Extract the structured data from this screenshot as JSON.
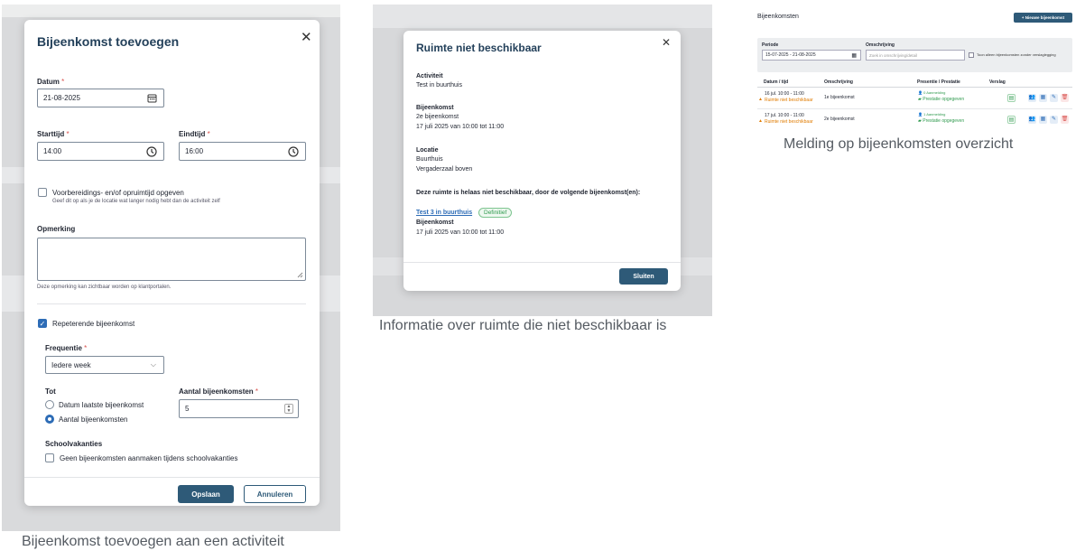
{
  "panel1": {
    "title": "Bijeenkomst toevoegen",
    "date_label": "Datum",
    "date_value": "21-08-2025",
    "start_label": "Starttijd",
    "start_value": "14:00",
    "end_label": "Eindtijd",
    "end_value": "16:00",
    "prep_label": "Voorbereidings- en/of opruimtijd opgeven",
    "prep_help": "Geef dit op als je de locatie wat langer nodig hebt dan de activiteit zelf",
    "remark_label": "Opmerking",
    "remark_help": "Deze opmerking kan zichtbaar worden op klantportalen.",
    "repeat_label": "Repeterende bijeenkomst",
    "freq_label": "Frequentie",
    "freq_value": "Iedere week",
    "until_label": "Tot",
    "until_opt1": "Datum laatste bijeenkomst",
    "until_opt2": "Aantal bijeenkomsten",
    "count_label": "Aantal bijeenkomsten",
    "count_value": "5",
    "school_label": "Schoolvakanties",
    "school_opt": "Geen bijeenkomsten aanmaken tijdens schoolvakanties",
    "save": "Opslaan",
    "cancel": "Annuleren",
    "caption": "Bijeenkomst toevoegen aan een activiteit"
  },
  "panel2": {
    "title": "Ruimte niet beschikbaar",
    "activity_label": "Activiteit",
    "activity_value": "Test in buurthuis",
    "meeting_label": "Bijeenkomst",
    "meeting_name": "2e bijeenkomst",
    "meeting_time": "17 juli 2025 van 10:00 tot 11:00",
    "location_label": "Locatie",
    "location_1": "Buurthuis",
    "location_2": "Vergaderzaal boven",
    "warning": "Deze ruimte is helaas niet beschikbaar, door de volgende bijeenkomst(en):",
    "conflict_link": "Test 3 in buurthuis",
    "conflict_badge": "Definitief",
    "conflict_type": "Bijeenkomst",
    "conflict_time": "17 juli 2025 van 10:00 tot 11:00",
    "close": "Sluiten",
    "caption": "Informatie over ruimte die niet beschikbaar is"
  },
  "panel3": {
    "title": "Bijeenkomsten",
    "new_button": "+ Nieuwe bijeenkomst",
    "period_label": "Periode",
    "period_value": "15-07-2025 - 21-08-2025",
    "desc_label": "Omschrijving",
    "desc_placeholder": "Zoek in omschrijving/detail",
    "only_label": "Toon alleen bijeenkomsten zonder verslaglegging",
    "col_date": "Datum / tijd",
    "col_desc": "Omschrijving",
    "col_presence": "Presentie / Prestatie",
    "col_report": "Verslag",
    "rows": [
      {
        "date": "16 jul. 10:00 - 11:00",
        "warning": "Ruimte niet beschikbaar",
        "desc": "1e bijeenkomst",
        "p1": "0 Aanmelding",
        "p2": "Prestatie opgegeven"
      },
      {
        "date": "17 jul. 10:00 - 11:00",
        "warning": "Ruimte niet beschikbaar",
        "desc": "2e bijeenkomst",
        "p1": "1 Aanmelding",
        "p2": "Prestatie opgegeven"
      }
    ],
    "caption": "Melding op bijeenkomsten overzicht"
  },
  "colors": {
    "primary": "#2e5a78",
    "accent": "#2d6cb6",
    "warning": "#e07b00",
    "success": "#2f9a4e",
    "danger": "#d9534f"
  }
}
